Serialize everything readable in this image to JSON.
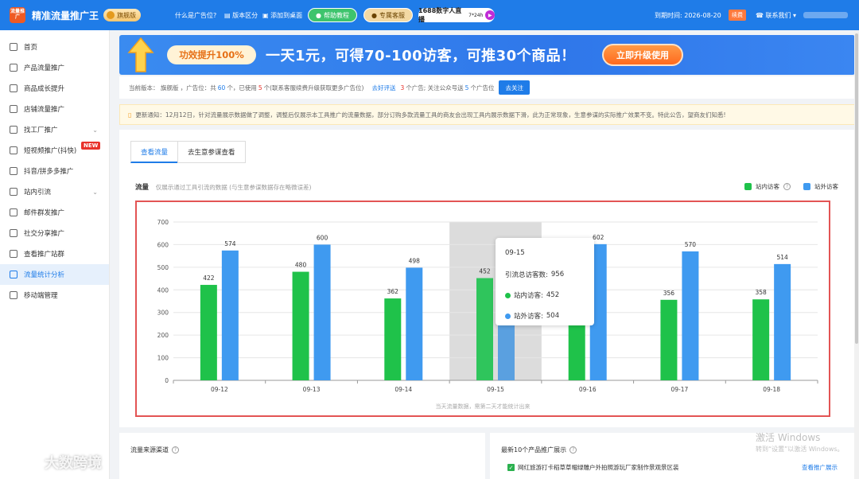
{
  "app": {
    "logo_text": "流量推广",
    "title": "精准流量推广王",
    "edition_badge": "旗舰版"
  },
  "topnav": {
    "what_is_slot": "什么是广告位?",
    "version_diff": "版本区分",
    "add_desktop": "添加到桌面",
    "help": "帮助教程",
    "service": "专属客服",
    "live": "1688数字人直播",
    "live_sub": "7*24h",
    "expire_label": "到期时间: 2026-08-20",
    "renew": "续费",
    "contact": "联系我们"
  },
  "sidebar": {
    "items": [
      {
        "label": "首页",
        "icon": "home-icon"
      },
      {
        "label": "产品流量推广",
        "icon": "box-icon"
      },
      {
        "label": "商品成长提升",
        "icon": "bag-icon"
      },
      {
        "label": "店铺流量推广",
        "icon": "store-icon"
      },
      {
        "label": "找工厂推广",
        "icon": "factory-icon",
        "expandable": true
      },
      {
        "label": "短视频推广(抖快)",
        "icon": "video-icon",
        "badge": "NEW"
      },
      {
        "label": "抖音/拼多多推广",
        "icon": "tiktok-icon"
      },
      {
        "label": "站内引流",
        "icon": "tv-icon",
        "expandable": true
      },
      {
        "label": "邮件群发推广",
        "icon": "mail-icon"
      },
      {
        "label": "社交分享推广",
        "icon": "share-icon"
      },
      {
        "label": "查看推广站群",
        "icon": "megaphone-icon"
      },
      {
        "label": "流量统计分析",
        "icon": "chart-icon",
        "active": true
      },
      {
        "label": "移动端管理",
        "icon": "user-icon"
      }
    ]
  },
  "banner": {
    "tag": "功效提升100%",
    "headline": "一天1元，可得70-100访客，可推30个商品！",
    "cta": "立即升级使用"
  },
  "edition_row": {
    "p1": "当前版本： 旗舰版 ，广告位：共",
    "total": "60",
    "p2": "个，已使用",
    "used": "5",
    "p3": "个(联系客服续费升级获取更多广告位)",
    "link": "去好评送",
    "reward": "3",
    "p4": "个广告; 关注公众号送",
    "reward2": "5",
    "p5": "个广告位",
    "follow_btn": "去关注"
  },
  "notice": {
    "text": "更新通知：12月12日，针对流量展示数据做了调整，调整后仅展示本工具推广的流量数据，部分订购多款流量工具的商友会出现工具内展示数据下滑，此为正常现象，生意参谋的实际推广效果不变。特此公告，望商友们知悉!"
  },
  "tabs": [
    {
      "label": "查看流量",
      "active": true
    },
    {
      "label": "去生意参谋查看",
      "active": false
    }
  ],
  "chart_header": {
    "title": "流量",
    "subtitle": "仅展示通过工具引流的数据 (与生意参谋数据存在略微误差)"
  },
  "colors": {
    "internal": "#1fc24a",
    "external": "#3f9af0",
    "accent": "#1f7ce8"
  },
  "chart_data": {
    "type": "bar",
    "categories": [
      "09-12",
      "09-13",
      "09-14",
      "09-15",
      "09-16",
      "09-17",
      "09-18"
    ],
    "series": [
      {
        "name": "站内访客",
        "values": [
          422,
          480,
          362,
          452,
          346,
          356,
          358
        ]
      },
      {
        "name": "站外访客",
        "values": [
          574,
          600,
          498,
          504,
          602,
          570,
          514
        ]
      }
    ],
    "ylim": [
      0,
      700
    ],
    "yticks": [
      0,
      100,
      200,
      300,
      400,
      500,
      600,
      700
    ],
    "grid": true,
    "legend": "top-right",
    "highlighted_category": "09-15",
    "footnote": "当天流量数据，需第二天才能统计出来"
  },
  "tooltip": {
    "date": "09-15",
    "total_label": "引流总访客数:",
    "total_value": "956",
    "internal_label": "站内访客:",
    "internal_value": "452",
    "external_label": "站外访客:",
    "external_value": "504"
  },
  "cards": {
    "source_title": "流量来源渠道",
    "latest_title": "最新10个产品推广展示",
    "product_name": "网红旅游打卡稻草草帽绿雕户外拍照游玩厂家制作景观景区装",
    "view_more": "查看推广展示"
  },
  "overlays": {
    "windows_title": "激活 Windows",
    "windows_sub": "转到“设置”以激活 Windows。",
    "brand": "大数跨境"
  }
}
